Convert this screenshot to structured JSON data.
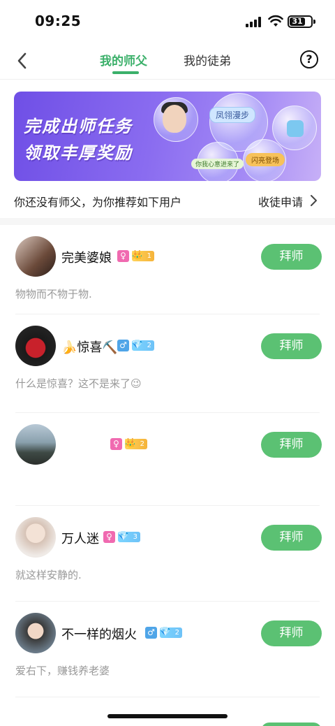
{
  "status_bar": {
    "time": "09:25",
    "battery_level": "31"
  },
  "nav": {
    "tabs": [
      {
        "label": "我的师父",
        "active": true
      },
      {
        "label": "我的徒弟",
        "active": false
      }
    ],
    "help_symbol": "?"
  },
  "banner": {
    "line1": "完成出师任务",
    "line2": "领取丰厚奖励",
    "bubble_tags": [
      "凤翎漫步",
      "闪亮登场",
      "你我心意",
      "进来了"
    ]
  },
  "recommend": {
    "text": "你还没有师父，为你推荐如下用户",
    "link_label": "收徒申请"
  },
  "colors": {
    "accent": "#3bb06a",
    "button": "#5bc173",
    "female": "#f06ab0",
    "male": "#4fa5e8"
  },
  "users": [
    {
      "name": "完美婆娘",
      "gender": "female",
      "gender_symbol": "♀",
      "level_type": "crown",
      "level": "1",
      "bio": "物物而不物于物.",
      "button_label": "拜师"
    },
    {
      "name": "🍌惊喜⛏️",
      "gender": "male",
      "gender_symbol": "♂",
      "level_type": "diamond",
      "level": "2",
      "bio": "什么是惊喜？这不是来了😉",
      "button_label": "拜师"
    },
    {
      "name": "",
      "gender": "female",
      "gender_symbol": "♀",
      "level_type": "crown",
      "level": "2",
      "bio": "",
      "button_label": "拜师"
    },
    {
      "name": "万人迷",
      "gender": "female",
      "gender_symbol": "♀",
      "level_type": "diamond",
      "level": "3",
      "bio": "就这样安静的.",
      "button_label": "拜师"
    },
    {
      "name": "不一样的烟火",
      "gender": "male",
      "gender_symbol": "♂",
      "level_type": "diamond",
      "level": "2",
      "bio": "爱右下，赚钱养老婆",
      "button_label": "拜师"
    }
  ]
}
